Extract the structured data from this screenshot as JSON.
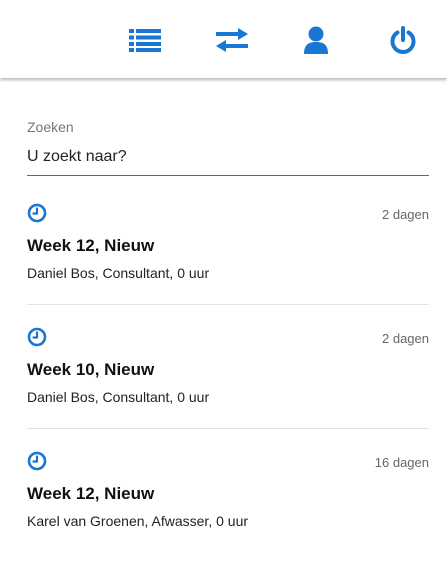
{
  "colors": {
    "accent": "#1976d2",
    "divider": "#e3e3e3",
    "muted_text": "#777777"
  },
  "toolbar": {
    "buttons": [
      {
        "icon": "list-icon"
      },
      {
        "icon": "swap-arrows-icon"
      },
      {
        "icon": "user-icon"
      },
      {
        "icon": "power-icon"
      }
    ]
  },
  "search": {
    "label": "Zoeken",
    "placeholder": "U zoekt naar?",
    "value": ""
  },
  "items": [
    {
      "icon": "clock-icon",
      "age": "2 dagen",
      "title": "Week 12, Nieuw",
      "subtitle": "Daniel Bos, Consultant, 0 uur"
    },
    {
      "icon": "clock-icon",
      "age": "2 dagen",
      "title": "Week 10, Nieuw",
      "subtitle": "Daniel Bos, Consultant, 0 uur"
    },
    {
      "icon": "clock-icon",
      "age": "16 dagen",
      "title": "Week 12, Nieuw",
      "subtitle": "Karel van Groenen, Afwasser, 0 uur"
    }
  ]
}
